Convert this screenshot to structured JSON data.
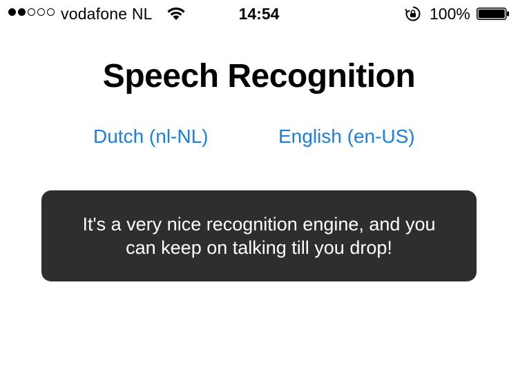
{
  "status_bar": {
    "signal": {
      "filled_bars": 2,
      "total_bars": 5
    },
    "carrier": "vodafone NL",
    "wifi_icon": "wifi-icon",
    "time": "14:54",
    "rotation_lock_icon": "rotation-lock-icon",
    "battery_percent": "100%",
    "battery_icon": "battery-icon",
    "battery_level": 1.0
  },
  "main": {
    "title": "Speech Recognition",
    "languages": [
      {
        "label": "Dutch (nl-NL)"
      },
      {
        "label": "English (en-US)"
      }
    ],
    "transcript": {
      "text": "It's a very nice recognition engine, and you can keep on talking till you drop!"
    }
  },
  "colors": {
    "link": "#1a7fe0",
    "card_background": "#2e2e2e",
    "card_text": "#ffffff",
    "background": "#ffffff"
  }
}
